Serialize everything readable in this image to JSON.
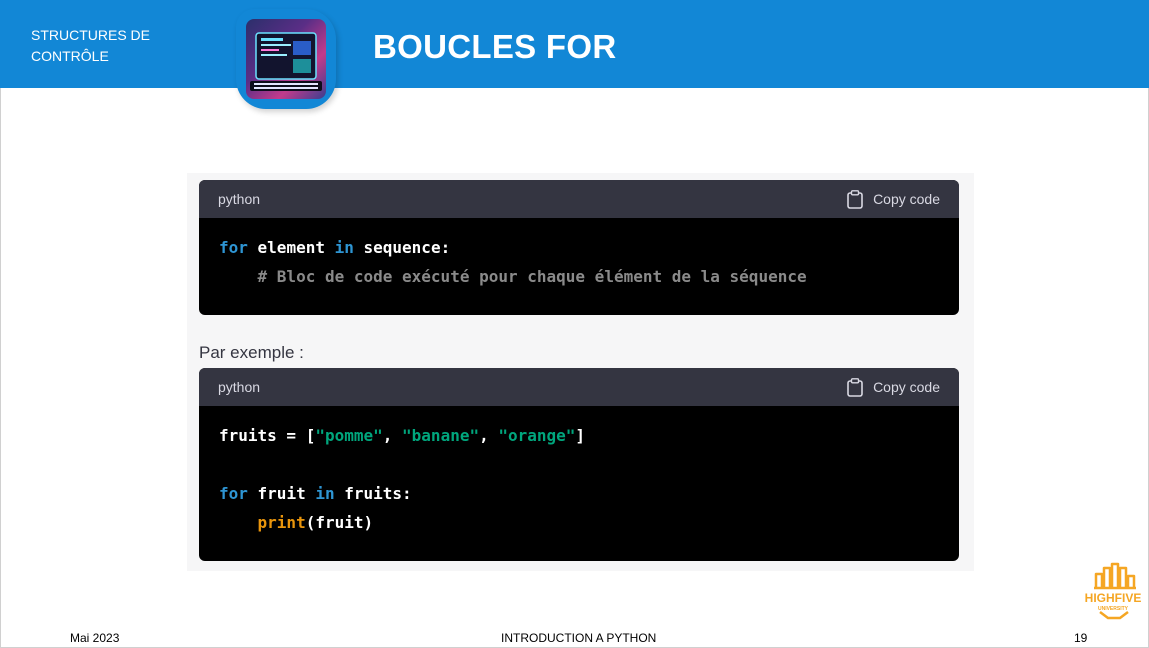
{
  "header": {
    "section_line1": "STRUCTURES DE",
    "section_line2": "CONTRÔLE",
    "title": "BOUCLES FOR"
  },
  "block1": {
    "lang": "python",
    "copy_label": "Copy code",
    "line1": {
      "kw1": "for",
      "var": " element ",
      "kw2": "in",
      "rest": " sequence:"
    },
    "line2": {
      "indent": "    ",
      "comment": "# Bloc de code exécuté pour chaque élément de la séquence"
    }
  },
  "example_label": "Par exemple :",
  "block2": {
    "lang": "python",
    "copy_label": "Copy code",
    "line1": {
      "pre": "fruits = [",
      "s1": "\"pomme\"",
      "c1": ", ",
      "s2": "\"banane\"",
      "c2": ", ",
      "s3": "\"orange\"",
      "post": "]"
    },
    "line3": {
      "kw1": "for",
      "var": " fruit ",
      "kw2": "in",
      "rest": " fruits:"
    },
    "line4": {
      "indent": "    ",
      "fn": "print",
      "rest": "(fruit)"
    }
  },
  "footer": {
    "date": "Mai 2023",
    "course": "INTRODUCTION A PYTHON",
    "page": "19"
  },
  "logo": {
    "text": "HIGHFIVE",
    "sub": "UNIVERSITY",
    "color": "#f5a623"
  },
  "icons": {
    "copy": "clipboard-icon"
  },
  "colors": {
    "header_blue": "#1287d6",
    "code_bg": "#000000",
    "code_head_bg": "#343541",
    "keyword": "#2e95d3",
    "string": "#00a67d",
    "builtin": "#e9950c",
    "comment": "#8a8a8a"
  }
}
